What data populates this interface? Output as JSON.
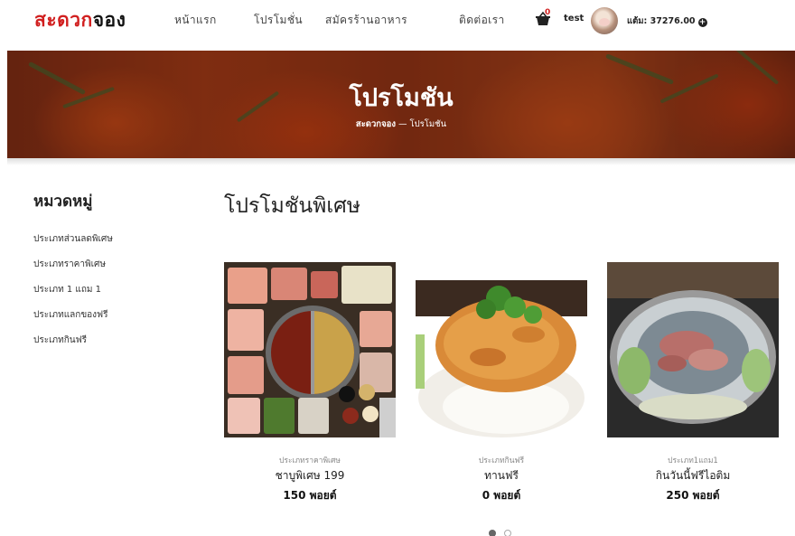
{
  "header": {
    "logo_red": "สะดวก",
    "logo_dark": "จอง",
    "nav": [
      {
        "label": "หน้าแรก"
      },
      {
        "label": "โปรโมชั่น"
      },
      {
        "label": "สมัครร้านอาหาร"
      },
      {
        "label": "ติดต่อเรา"
      }
    ],
    "cart_icon": "cart-icon",
    "cart_count": "0",
    "username": "test",
    "points": "แต้ม: 37276.00"
  },
  "banner": {
    "title": "โปรโมชัน",
    "breadcrumb_home": "สะดวกจอง",
    "breadcrumb_sep": "—",
    "breadcrumb_current": "โปรโมชัน"
  },
  "sidebar": {
    "title": "หมวดหมู่",
    "items": [
      {
        "label": "ประเภทส่วนลดพิเศษ"
      },
      {
        "label": "ประเภทราคาพิเศษ"
      },
      {
        "label": "ประเภท 1 แถม 1"
      },
      {
        "label": "ประเภทแลกของฟรี"
      },
      {
        "label": "ประเภทกินฟรี"
      }
    ]
  },
  "main": {
    "title": "โปรโมชันพิเศษ",
    "cards": [
      {
        "category": "ประเภทราคาพิเศษ",
        "name": "ชาบูพิเศษ 199",
        "points": "150 พอยต์"
      },
      {
        "category": "ประเภทกินฟรี",
        "name": "ทานฟรี",
        "points": "0 พอยต์"
      },
      {
        "category": "ประเภท1แถม1",
        "name": "กินวันนี้ฟรีไอติม",
        "points": "250 พอยต์"
      }
    ],
    "carousel": {
      "pages": 2,
      "active": 1
    }
  },
  "colors": {
    "brand_red": "#d11f1f",
    "text_dark": "#222222"
  }
}
